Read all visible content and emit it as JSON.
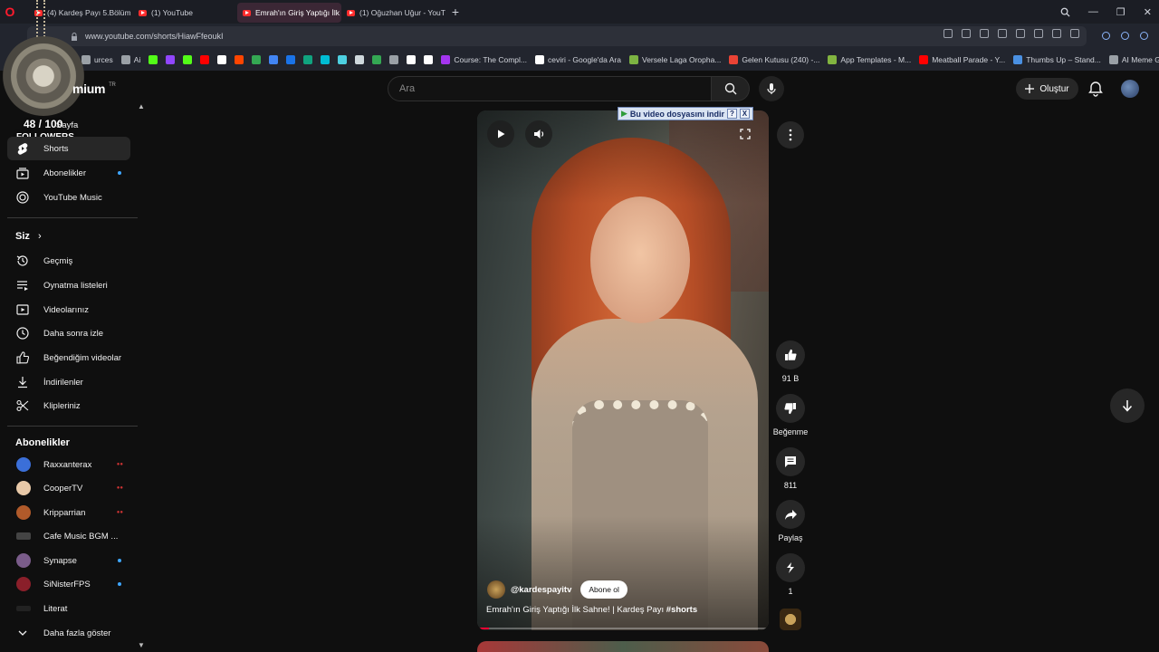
{
  "browser": {
    "tabs": [
      {
        "label": "(4) Kardeş Payı 5.Bölüm (1"
      },
      {
        "label": "(1) YouTube"
      },
      {
        "label": "Emrah'ın Giriş Yaptığı İlk S"
      },
      {
        "label": "(1) Oğuzhan Uğur - YouTu"
      }
    ],
    "url": "www.youtube.com/shorts/HiawFfeoukI",
    "bookmarks": [
      {
        "label": "urces",
        "color": "#9aa0a6"
      },
      {
        "label": "Ai",
        "color": "#9aa0a6"
      },
      {
        "label": "",
        "color": "#53fc18"
      },
      {
        "label": "",
        "color": "#9146ff"
      },
      {
        "label": "",
        "color": "#53fc18"
      },
      {
        "label": "",
        "color": "#ff0000"
      },
      {
        "label": "",
        "color": "#ffffff"
      },
      {
        "label": "",
        "color": "#ff4500"
      },
      {
        "label": "",
        "color": "#34a853"
      },
      {
        "label": "",
        "color": "#4285f4"
      },
      {
        "label": "",
        "color": "#1a73e8"
      },
      {
        "label": "",
        "color": "#10a37f"
      },
      {
        "label": "",
        "color": "#00bcd4"
      },
      {
        "label": "",
        "color": "#4dd0e1"
      },
      {
        "label": "",
        "color": "#cfd8dc"
      },
      {
        "label": "",
        "color": "#34a853"
      },
      {
        "label": "",
        "color": "#9aa0a6"
      },
      {
        "label": "",
        "color": "#ffffff"
      },
      {
        "label": "",
        "color": "#ffffff"
      },
      {
        "label": "Course: The Compl...",
        "color": "#a435f0"
      },
      {
        "label": "ceviri - Google'da Ara",
        "color": "#ffffff"
      },
      {
        "label": "Versele Laga Oropha...",
        "color": "#7cb342"
      },
      {
        "label": "Gelen Kutusu (240) -...",
        "color": "#ea4335"
      },
      {
        "label": "App Templates - M...",
        "color": "#82b440"
      },
      {
        "label": "Meatball Parade - Y...",
        "color": "#ff0000"
      },
      {
        "label": "Thumbs Up – Stand...",
        "color": "#4a90e2"
      },
      {
        "label": "AI Meme Generator...",
        "color": "#9aa0a6"
      }
    ]
  },
  "overlay": {
    "followers_count": "48 / 100",
    "followers_label": "FOLLOWERS"
  },
  "header": {
    "brand": "mium",
    "region": "TR",
    "search_placeholder": "Ara",
    "create_label": "Oluştur"
  },
  "sidebar": {
    "home_label": "Sayfa",
    "items": [
      {
        "label": "Shorts"
      },
      {
        "label": "Abonelikler"
      },
      {
        "label": "YouTube Music"
      }
    ],
    "you_heading": "Siz",
    "you_items": [
      {
        "label": "Geçmiş"
      },
      {
        "label": "Oynatma listeleri"
      },
      {
        "label": "Videolarınız"
      },
      {
        "label": "Daha sonra izle"
      },
      {
        "label": "Beğendiğim videolar"
      },
      {
        "label": "İndirilenler"
      },
      {
        "label": "Klipleriniz"
      }
    ],
    "subs_heading": "Abonelikler",
    "subscriptions": [
      {
        "label": "Raxxanterax",
        "status": "live",
        "color": "#3b6fd8"
      },
      {
        "label": "CooperTV",
        "status": "live",
        "color": "#e8c9a8"
      },
      {
        "label": "Kripparrian",
        "status": "live",
        "color": "#b05a2a"
      },
      {
        "label": "Cafe Music BGM ...",
        "status": "",
        "color": "#444444"
      },
      {
        "label": "Synapse",
        "status": "new",
        "color": "#7a5c8a"
      },
      {
        "label": "SiNisterFPS",
        "status": "new",
        "color": "#8a1f2a"
      },
      {
        "label": "Literat",
        "status": "",
        "color": "#222222"
      }
    ],
    "show_more_label": "Daha fazla göster"
  },
  "short": {
    "download_banner": "Bu video dosyasını indir",
    "download_help": "?",
    "download_close": "X",
    "channel_handle": "@kardespayitv",
    "subscribe_label": "Abone ol",
    "title": "Emrah'ın Giriş Yaptığı İlk Sahne! | Kardeş Payı",
    "hashtag": "#shorts",
    "progress": 0.04
  },
  "actions": {
    "likes": "91 B",
    "dislike_label": "Beğenme",
    "comments": "811",
    "share_label": "Paylaş",
    "remix_count": "1"
  },
  "colors": {
    "accent_red": "#ff0033",
    "active_bg": "#272727",
    "new_dot": "#3ea6ff"
  }
}
